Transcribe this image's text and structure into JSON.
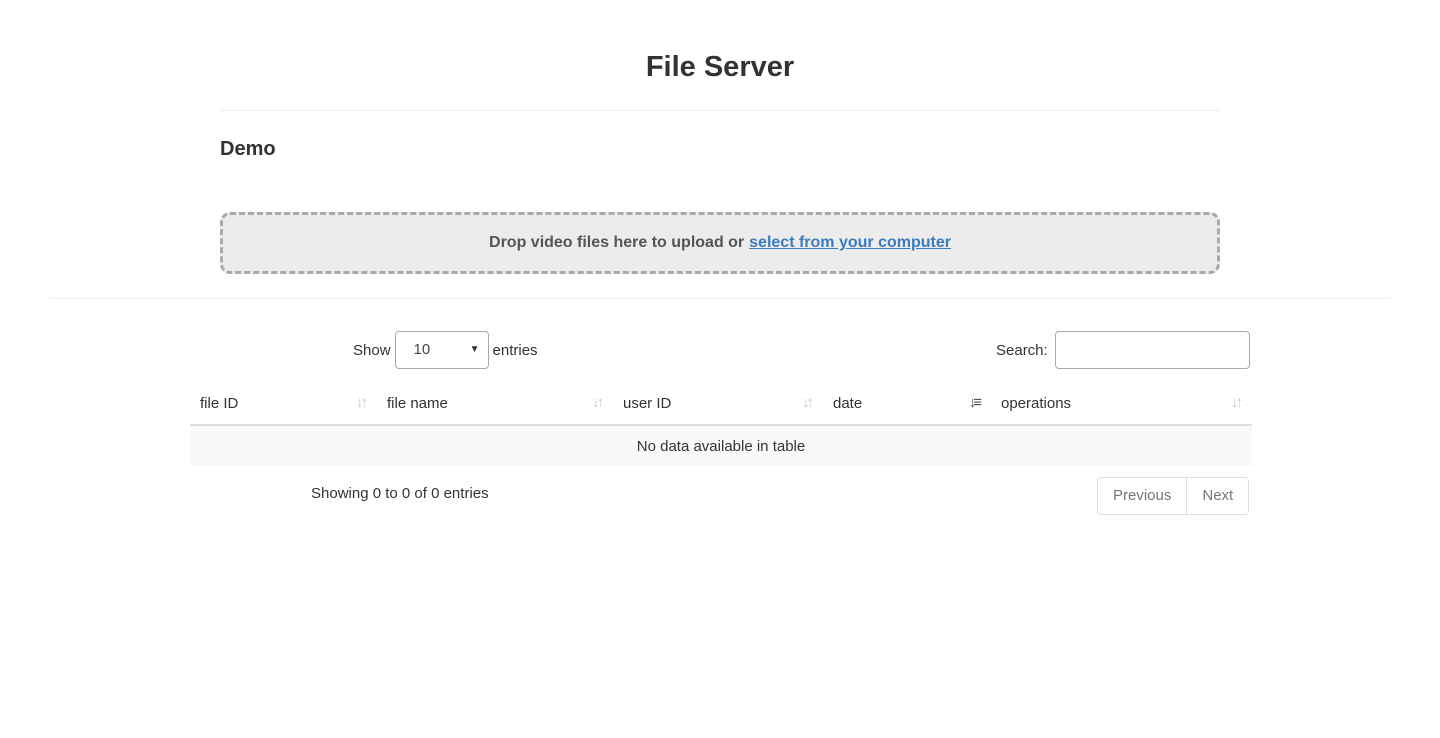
{
  "header": {
    "title": "File Server"
  },
  "section": {
    "title": "Demo"
  },
  "dropzone": {
    "text": "Drop video files here to upload or",
    "link": "select from your computer"
  },
  "table_controls": {
    "show_label": "Show",
    "entries_label": "entries",
    "page_size": "10",
    "search_label": "Search:",
    "search_value": ""
  },
  "table": {
    "columns": [
      {
        "label": "file ID",
        "sort": "unsorted"
      },
      {
        "label": "file name",
        "sort": "unsorted"
      },
      {
        "label": "user ID",
        "sort": "unsorted"
      },
      {
        "label": "date",
        "sort": "descending"
      },
      {
        "label": "operations",
        "sort": "unsorted"
      }
    ],
    "empty_message": "No data available in table"
  },
  "footer": {
    "info": "Showing 0 to 0 of 0 entries",
    "previous": "Previous",
    "next": "Next"
  }
}
